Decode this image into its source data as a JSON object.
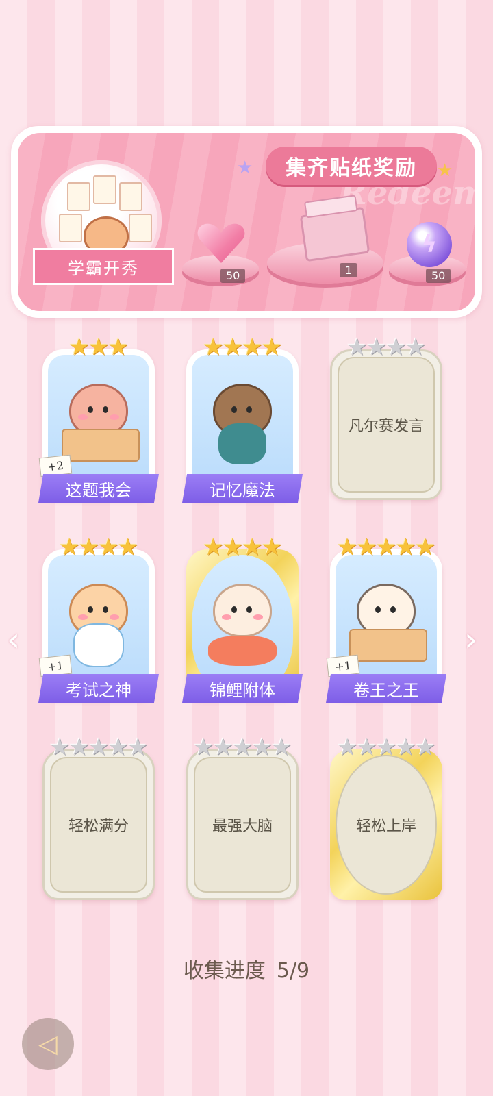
{
  "reward_banner": {
    "title": "集齐贴纸奖励",
    "watermark": "Redeem",
    "set_label": "学霸开秀",
    "rewards": [
      {
        "icon": "heart-gem-icon",
        "count": "50"
      },
      {
        "icon": "gift-box-icon",
        "count": "1"
      },
      {
        "icon": "energy-orb-icon",
        "count": "50"
      }
    ]
  },
  "stickers": [
    {
      "name": "这题我会",
      "stars": 3,
      "max_stars": 3,
      "collected": true,
      "bonus": "+2",
      "frame": "normal"
    },
    {
      "name": "记忆魔法",
      "stars": 4,
      "max_stars": 4,
      "collected": true,
      "bonus": "",
      "frame": "normal"
    },
    {
      "name": "凡尔赛发言",
      "stars": 0,
      "max_stars": 4,
      "collected": false,
      "bonus": "",
      "frame": "normal"
    },
    {
      "name": "考试之神",
      "stars": 4,
      "max_stars": 4,
      "collected": true,
      "bonus": "+1",
      "frame": "normal"
    },
    {
      "name": "锦鲤附体",
      "stars": 4,
      "max_stars": 4,
      "collected": true,
      "bonus": "",
      "frame": "gold"
    },
    {
      "name": "卷王之王",
      "stars": 5,
      "max_stars": 5,
      "collected": true,
      "bonus": "+1",
      "frame": "normal"
    },
    {
      "name": "轻松满分",
      "stars": 0,
      "max_stars": 5,
      "collected": false,
      "bonus": "",
      "frame": "normal"
    },
    {
      "name": "最强大脑",
      "stars": 0,
      "max_stars": 5,
      "collected": false,
      "bonus": "",
      "frame": "normal"
    },
    {
      "name": "轻松上岸",
      "stars": 0,
      "max_stars": 5,
      "collected": false,
      "bonus": "",
      "frame": "gold"
    }
  ],
  "progress": {
    "label": "收集进度",
    "value": "5/9"
  },
  "colors": {
    "accent": "#ec7a99",
    "ribbon": "#8d6ef0",
    "star": "#f8c23a",
    "background": "#fde6ec"
  }
}
